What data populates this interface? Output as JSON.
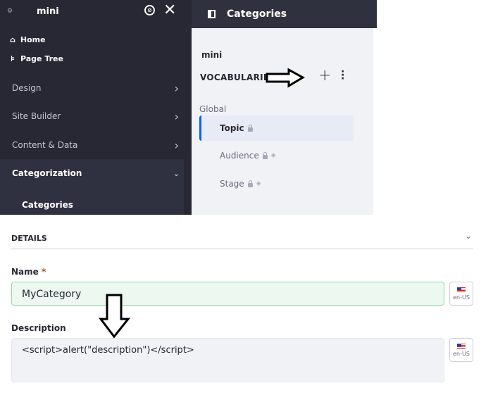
{
  "sidebar": {
    "site": "mini",
    "items": {
      "home": "Home",
      "page_tree": "Page Tree",
      "design": "Design",
      "site_builder": "Site Builder",
      "content": "Content & Data",
      "categorization": "Categorization",
      "categories": "Categories"
    }
  },
  "panel": {
    "title": "Categories",
    "site": "mini",
    "vocab_heading": "VOCABULARIES",
    "group": "Global",
    "vocabularies": [
      {
        "label": "Topic",
        "active": true
      },
      {
        "label": "Audience"
      },
      {
        "label": "Stage"
      }
    ]
  },
  "form": {
    "section": "DETAILS",
    "name_label": "Name",
    "required": "*",
    "name_value": "MyCategory",
    "desc_label": "Description",
    "desc_value": "<script>alert(\"description\")</script>",
    "lang": "en-US"
  },
  "colors": {
    "sidebar": "#272833",
    "accent": "#0b5fff",
    "valid": "#8fd9a0"
  }
}
